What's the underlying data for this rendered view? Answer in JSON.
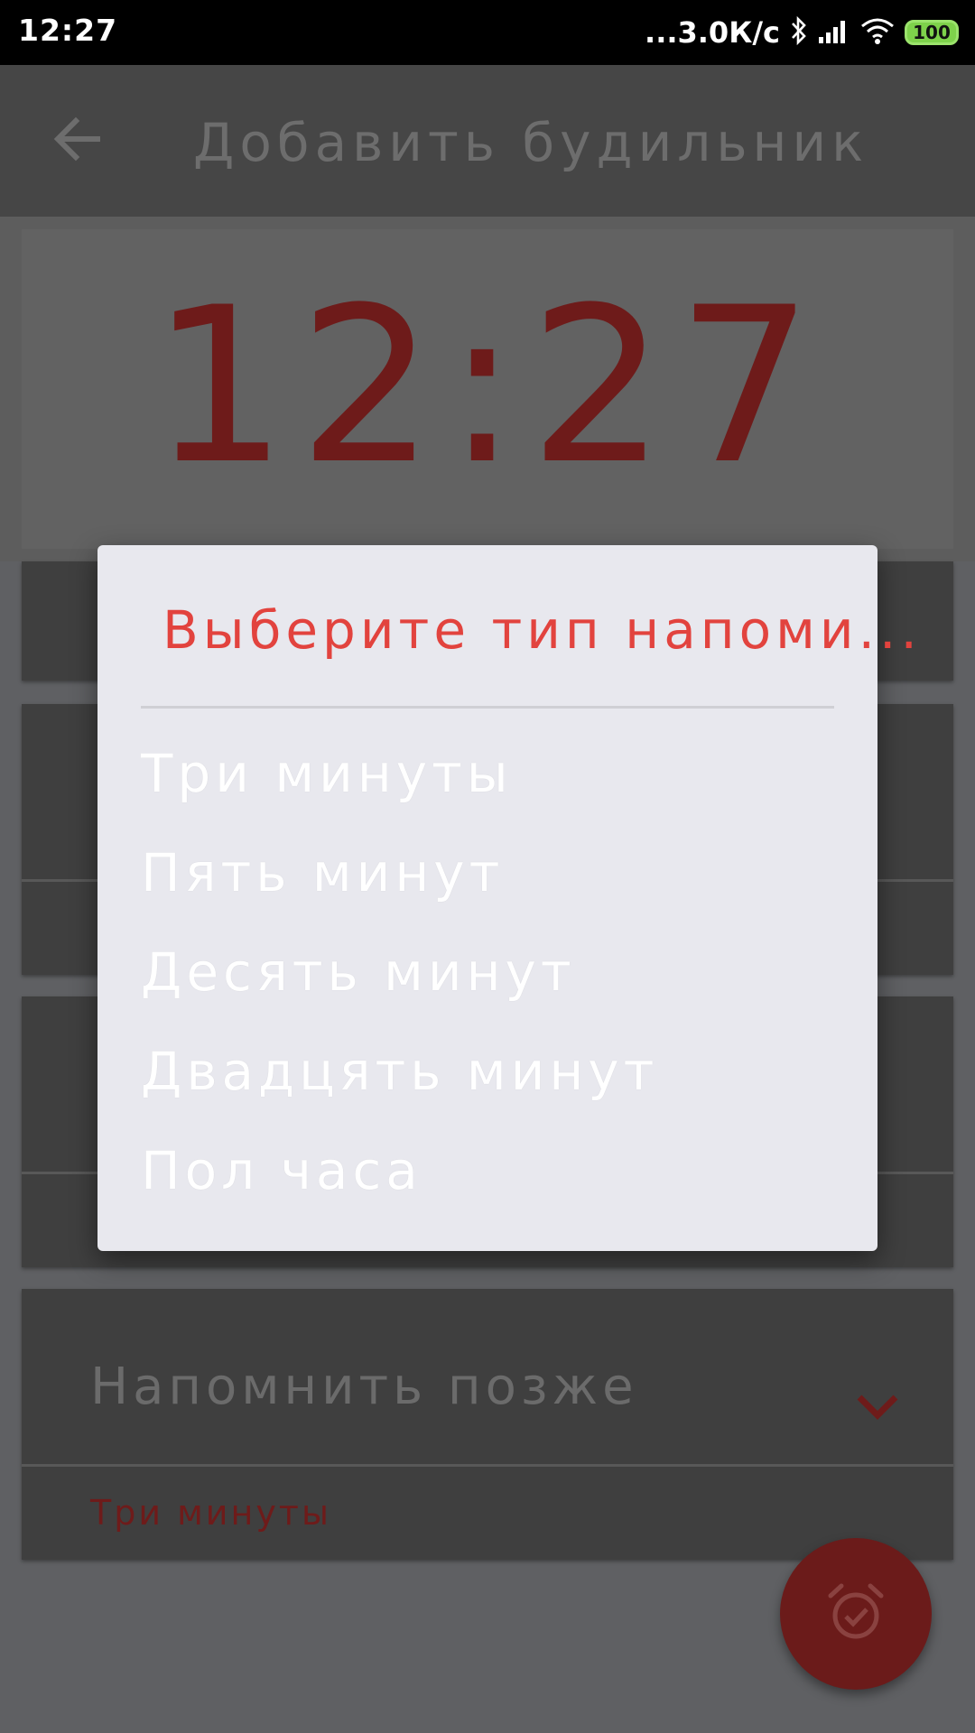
{
  "status_bar": {
    "time": "12:27",
    "net_speed": "...3.0К/с",
    "battery": "100"
  },
  "app_bar": {
    "title": "Добавить будильник",
    "back_icon": "arrow-left-icon"
  },
  "time_card": {
    "time": "12:27"
  },
  "background_fields": [
    {
      "label": "Напомнить позже",
      "value": "Три минуты",
      "dropdown_icon": "chevron-down-icon"
    }
  ],
  "fab": {
    "icon": "alarm-check-icon"
  },
  "dialog": {
    "title": "Выберите тип напоми...",
    "options": [
      "Три минуты",
      "Пять минут",
      "Десять минут",
      "Двадцять минут",
      "Пол часа"
    ]
  },
  "colors": {
    "accent_red": "#e2433e",
    "dim_red": "#6e1b1a",
    "dialog_bg": "#e8e8ee",
    "scrim": "#5f6063"
  }
}
